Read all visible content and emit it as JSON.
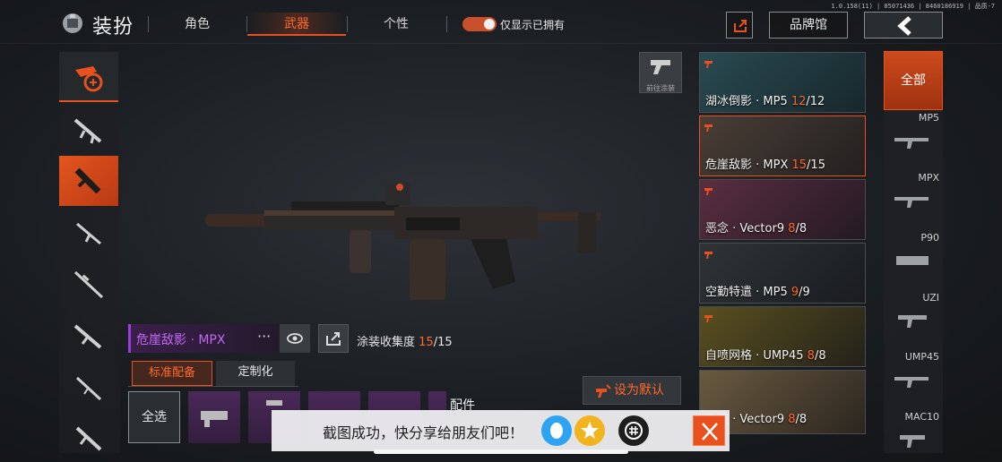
{
  "version": "1.0.158(11) | 05071436 | 8460186919 | 品质-7",
  "header": {
    "title": "装扮",
    "tabs": [
      {
        "label": "角色",
        "active": false
      },
      {
        "label": "武器",
        "active": true
      },
      {
        "label": "个性",
        "active": false
      }
    ],
    "toggle_label": "仅显示已拥有",
    "toggle_on": true,
    "brand_label": "品牌馆"
  },
  "paint_button_label": "前往涂装",
  "weapon": {
    "name": "危崖敌影 · MPX",
    "dots": "···",
    "collect_label": "涂装收集度",
    "collect_current": "15",
    "collect_total": "/15"
  },
  "subtabs": [
    "标准配备",
    "定制化"
  ],
  "select_all": "全选",
  "attachments_label": "配件",
  "set_default": "设为默认",
  "skins": [
    {
      "name": "湖冰倒影 · MP5 ",
      "current": "12",
      "total": "/12",
      "selected": false,
      "color": "#3a8fa0"
    },
    {
      "name": "危崖敌影 · MPX ",
      "current": "15",
      "total": "/15",
      "selected": true,
      "color": "#6a5a4e"
    },
    {
      "name": "恶念 · Vector9 ",
      "current": "8",
      "total": "/8",
      "selected": false,
      "color": "#9a4a6a"
    },
    {
      "name": "空勤特遣 · MP5 ",
      "current": "9",
      "total": "/9",
      "selected": false,
      "color": "#3d4248"
    },
    {
      "name": "自喷网格 · UMP45 ",
      "current": "8",
      "total": "/8",
      "selected": false,
      "color": "#8a7a2a"
    },
    {
      "name": "伪装 · Vector9 ",
      "current": "8",
      "total": "/8",
      "selected": false,
      "color": "#8a7450"
    }
  ],
  "filters": {
    "all": "全部",
    "items": [
      "MP5",
      "MPX",
      "P90",
      "UZI",
      "UMP45",
      "MAC10"
    ]
  },
  "toast": {
    "text": "截图成功，快分享给朋友们吧！"
  },
  "colors": {
    "accent": "#e8501e",
    "purple": "#9a3ee0"
  }
}
